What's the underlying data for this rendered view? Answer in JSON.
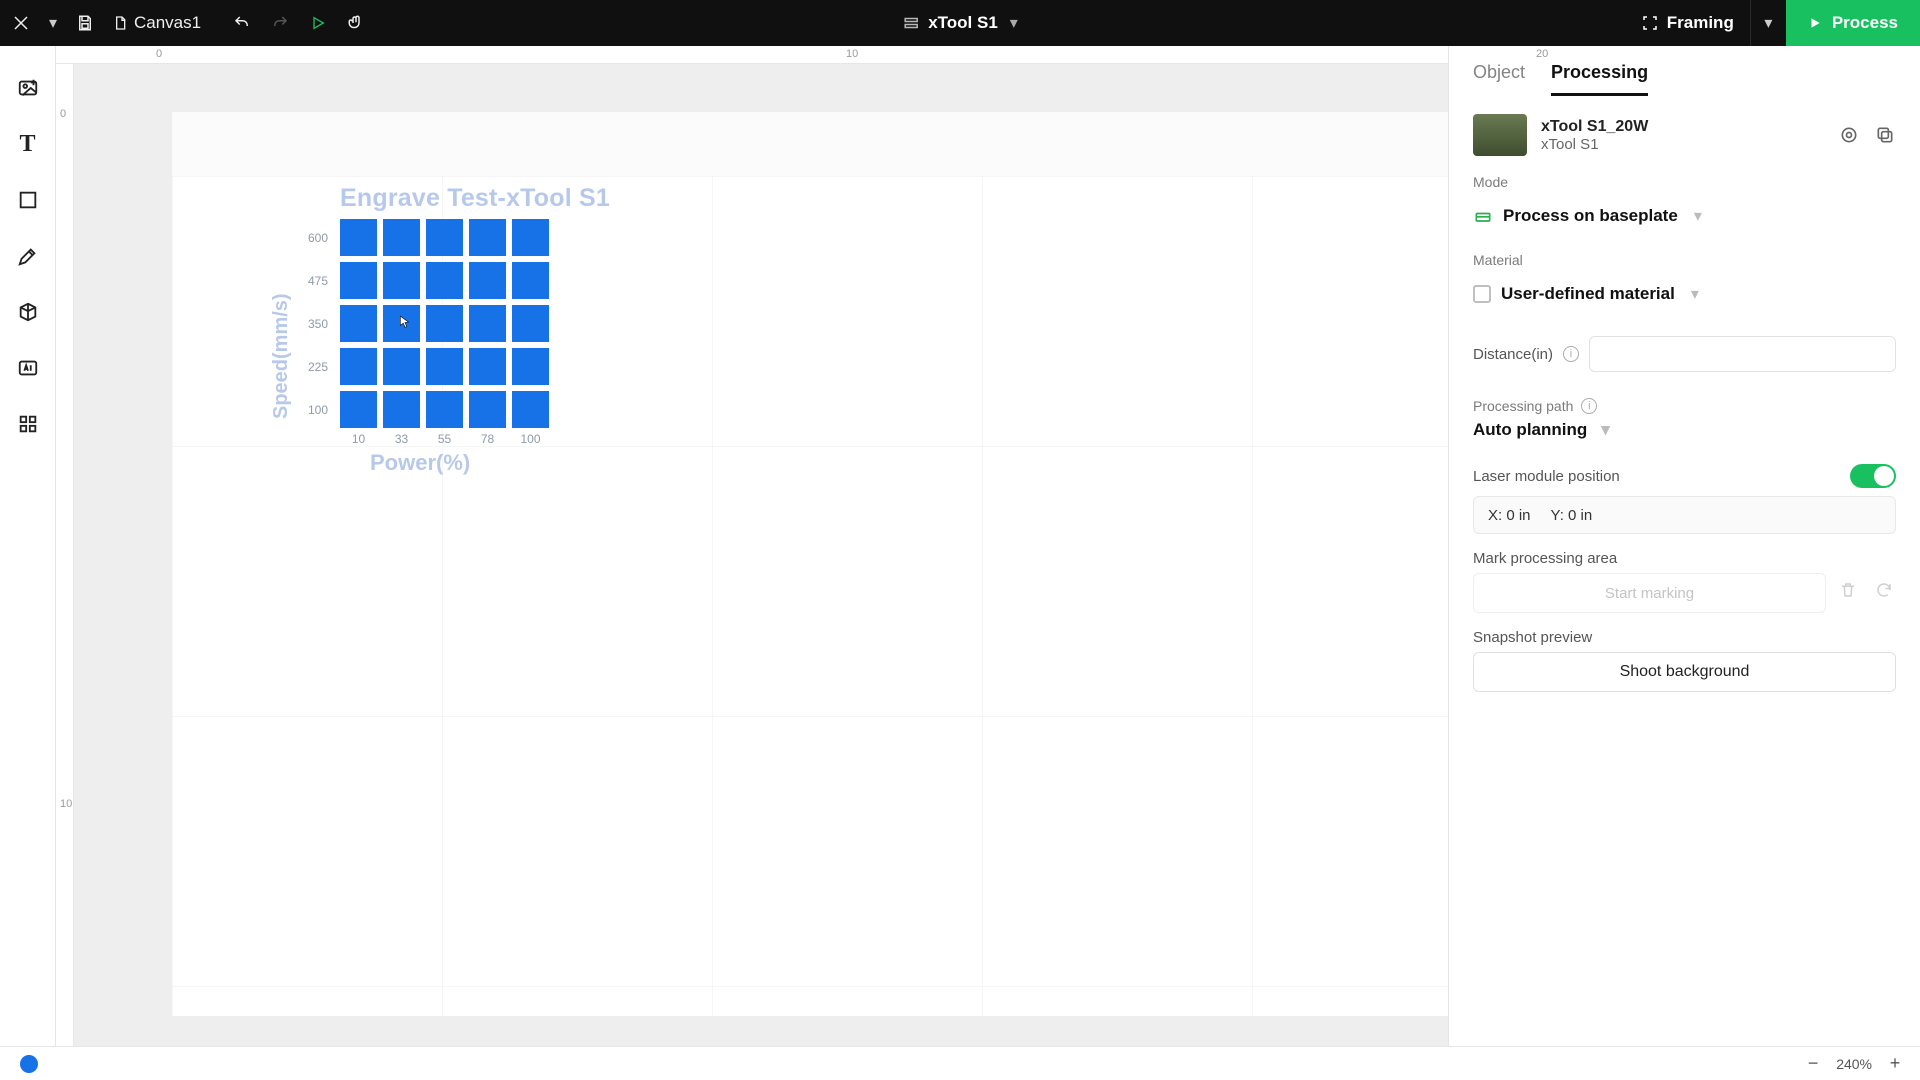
{
  "topbar": {
    "doc_label": "Canvas1",
    "machine_name": "xTool S1",
    "framing_label": "Framing",
    "process_label": "Process"
  },
  "ruler_h": {
    "t0": "0",
    "t10": "10",
    "t20": "20"
  },
  "ruler_v": {
    "t0": "0",
    "t10": "10"
  },
  "art": {
    "title": "Engrave Test-xTool S1",
    "y_axis_label": "Speed(mm/s)",
    "x_axis_label": "Power(%)",
    "y_ticks": [
      "600",
      "475",
      "350",
      "225",
      "100"
    ],
    "x_ticks": [
      "10",
      "33",
      "55",
      "78",
      "100"
    ]
  },
  "tabs": {
    "object": "Object",
    "processing": "Processing"
  },
  "machine": {
    "name": "xTool S1_20W",
    "sub": "xTool S1"
  },
  "mode": {
    "label": "Mode",
    "value": "Process on baseplate"
  },
  "material": {
    "label": "Material",
    "value": "User-defined material"
  },
  "distance": {
    "label": "Distance(in)"
  },
  "processing_path": {
    "label": "Processing path",
    "value": "Auto planning"
  },
  "lmp": {
    "label": "Laser module position",
    "x": "X: 0 in",
    "y": "Y: 0 in"
  },
  "mark": {
    "label": "Mark processing area",
    "button": "Start marking"
  },
  "snapshot": {
    "label": "Snapshot preview",
    "button": "Shoot background"
  },
  "zoom": {
    "value": "240%"
  },
  "chart_data": {
    "type": "heatmap",
    "title": "Engrave Test-xTool S1",
    "xlabel": "Power(%)",
    "ylabel": "Speed(mm/s)",
    "x_categories": [
      10,
      33,
      55,
      78,
      100
    ],
    "y_categories": [
      600,
      475,
      350,
      225,
      100
    ],
    "note": "5x5 engrave test grid; all cells rendered as filled blue squares in the design; actual engrave shades produced on material, not shown."
  }
}
